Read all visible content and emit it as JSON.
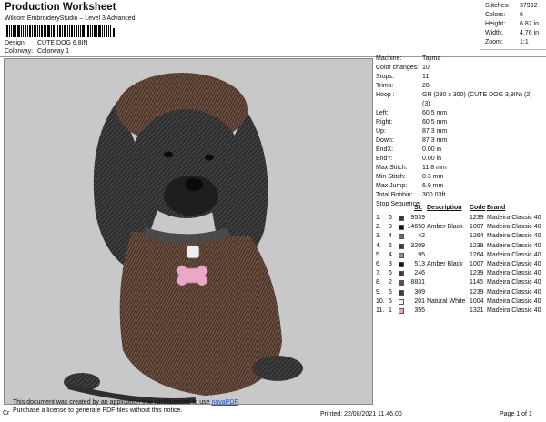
{
  "header": {
    "title": "Production Worksheet",
    "subtitle": "Wilcom EmbroideryStudio – Level 3 Advanced",
    "design_label": "Design:",
    "design_value": "CUTE DOG 6,8IN",
    "colorway_label": "Colorway:",
    "colorway_value": "Colorway 1"
  },
  "stats": {
    "stitches_label": "Stitches:",
    "stitches": "37992",
    "colors_label": "Colors:",
    "colors": "6",
    "height_label": "Height:",
    "height": "6.87 in",
    "width_label": "Width:",
    "width": "4.76 in",
    "zoom_label": "Zoom:",
    "zoom": "1:1"
  },
  "machine_info": [
    {
      "label": "Machine:",
      "value": "Tajima"
    },
    {
      "label": "Color changes:",
      "value": "10"
    },
    {
      "label": "Stops:",
      "value": "11"
    },
    {
      "label": "Trims:",
      "value": "28"
    },
    {
      "label": "Hoop :",
      "value": "GR (230 x 300) (CUTE DOG 3,8IN) (2)"
    },
    {
      "label": "",
      "value": "(3)"
    },
    {
      "label": "Left:",
      "value": "60.5 mm"
    },
    {
      "label": "Right:",
      "value": "60.5 mm"
    },
    {
      "label": "Up:",
      "value": "87.3 mm"
    },
    {
      "label": "Down:",
      "value": "87.3 mm"
    },
    {
      "label": "EndX:",
      "value": "0.00 in"
    },
    {
      "label": "EndY:",
      "value": "0.00 in"
    },
    {
      "label": "Max Stitch:",
      "value": "11.8 mm"
    },
    {
      "label": "Min Stitch:",
      "value": "0.3 mm"
    },
    {
      "label": "Max Jump:",
      "value": "6.9 mm"
    },
    {
      "label": "Total Bobbin:",
      "value": "300.03ft"
    },
    {
      "label": "Stop Sequence:",
      "value": ""
    }
  ],
  "stop_table": {
    "headers": {
      "st": "St.",
      "description": "Description",
      "code": "Code",
      "brand": "Brand"
    },
    "rows": [
      {
        "n": "1.",
        "c": "6",
        "color": "#3a3a3a",
        "st": "9539",
        "desc": "",
        "code": "1239",
        "brand": "Madeira Classic 40"
      },
      {
        "n": "2.",
        "c": "3",
        "color": "#111111",
        "st": "14650",
        "desc": "Amber Black",
        "code": "1007",
        "brand": "Madeira Classic 40"
      },
      {
        "n": "3.",
        "c": "4",
        "color": "#6e6e6e",
        "st": "42",
        "desc": "",
        "code": "1264",
        "brand": "Madeira Classic 40"
      },
      {
        "n": "4.",
        "c": "6",
        "color": "#3a3a3a",
        "st": "3209",
        "desc": "",
        "code": "1239",
        "brand": "Madeira Classic 40"
      },
      {
        "n": "5.",
        "c": "4",
        "color": "#8a8aa0",
        "st": "95",
        "desc": "",
        "code": "1264",
        "brand": "Madeira Classic 40"
      },
      {
        "n": "6.",
        "c": "3",
        "color": "#111111",
        "st": "513",
        "desc": "Amber Black",
        "code": "1007",
        "brand": "Madeira Classic 40"
      },
      {
        "n": "7.",
        "c": "6",
        "color": "#3a3a3a",
        "st": "246",
        "desc": "",
        "code": "1239",
        "brand": "Madeira Classic 40"
      },
      {
        "n": "8.",
        "c": "2",
        "color": "#6b4a3a",
        "st": "8831",
        "desc": "",
        "code": "1145",
        "brand": "Madeira Classic 40"
      },
      {
        "n": "9.",
        "c": "6",
        "color": "#3a3a3a",
        "st": "309",
        "desc": "",
        "code": "1239",
        "brand": "Madeira Classic 40"
      },
      {
        "n": "10.",
        "c": "5",
        "color": "#f4f4f4",
        "st": "201",
        "desc": "Natural White",
        "code": "1004",
        "brand": "Madeira Classic 40"
      },
      {
        "n": "11.",
        "c": "1",
        "color": "#e9a8c4",
        "st": "355",
        "desc": "",
        "code": "1321",
        "brand": "Madeira Classic 40"
      }
    ]
  },
  "footer": {
    "notice_line1": "This document was created by an application that isn't licensed to use",
    "notice_link": "novaPDF",
    "notice_line2": "Purchase a license to generate PDF files without this notice.",
    "cr": "Cr",
    "printed": "Printed: 22/08/2021 11.46.00",
    "page": "Page 1 of 1"
  },
  "colors": {
    "canvas_bg": "#c8c8c8",
    "link": "#2255cc"
  }
}
